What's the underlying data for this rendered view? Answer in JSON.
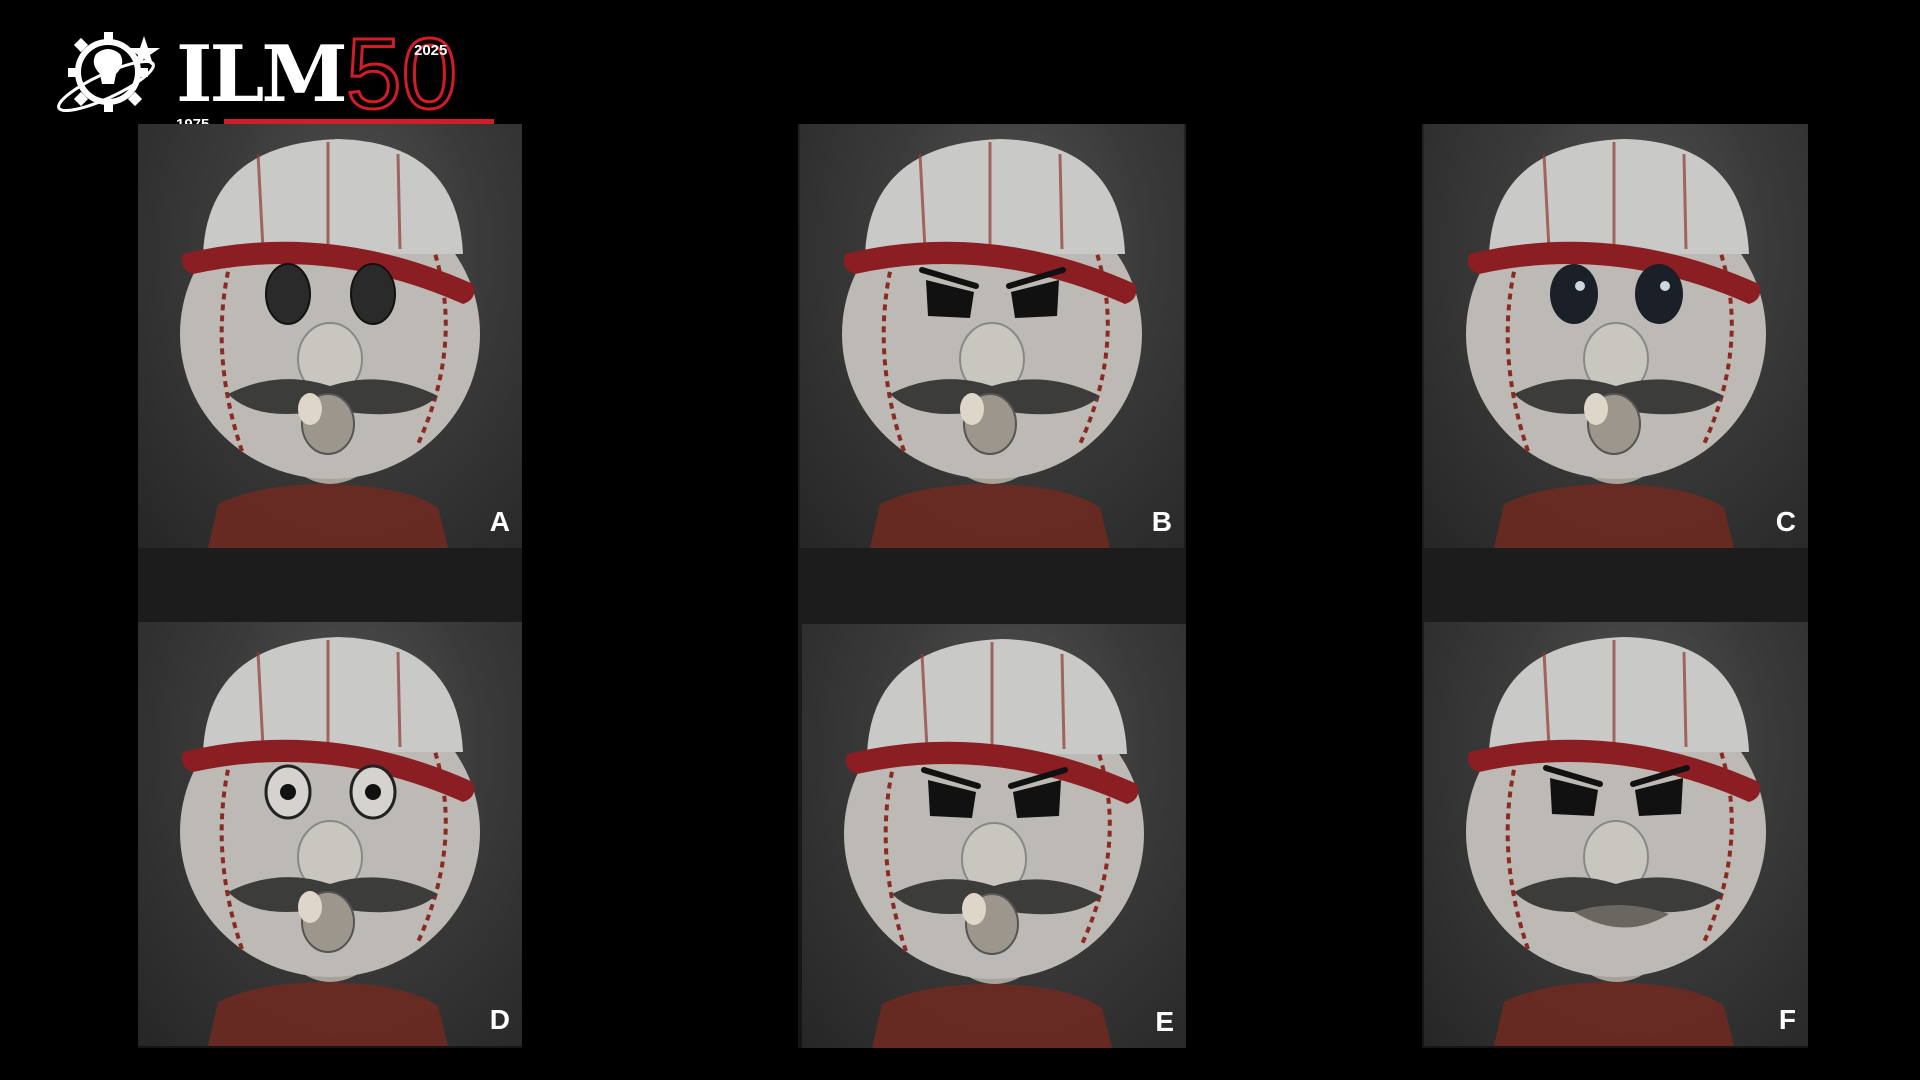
{
  "logo": {
    "wordmark": "ILM",
    "anniversary": "50",
    "year_start": "1975",
    "year_end": "2025",
    "colors": {
      "accent": "#d21c28",
      "text": "#ffffff"
    }
  },
  "panels": [
    {
      "label": "A",
      "expression": "neutral"
    },
    {
      "label": "B",
      "expression": "angry"
    },
    {
      "label": "C",
      "expression": "sad"
    },
    {
      "label": "D",
      "expression": "surprised"
    },
    {
      "label": "E",
      "expression": "angry-open"
    },
    {
      "label": "F",
      "expression": "scowl"
    }
  ],
  "colors": {
    "background": "#000000",
    "cap": "#c9c9c7",
    "brim": "#8a1e22",
    "face": "#bdbab5",
    "stitch": "#8b2a22",
    "mustache": "#3c3c3a"
  }
}
